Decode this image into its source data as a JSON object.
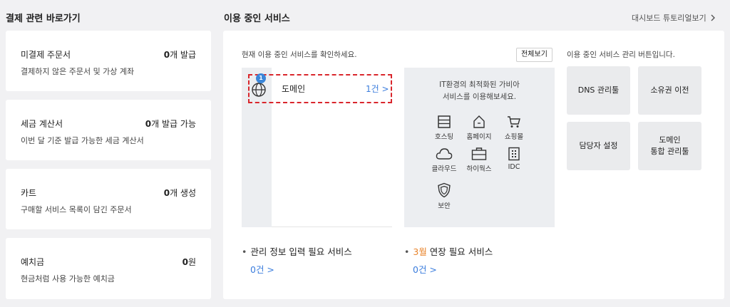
{
  "left_section": {
    "title": "결제 관련 바로가기",
    "cards": [
      {
        "title": "미결제 주문서",
        "count_num": "0",
        "count_unit": "개 발급",
        "desc": "결제하지 않은 주문서 및 가상 계좌"
      },
      {
        "title": "세금 계산서",
        "count_num": "0",
        "count_unit": "개 발급 가능",
        "desc": "이번 달 기준 발급 가능한 세금 계산서"
      },
      {
        "title": "카트",
        "count_num": "0",
        "count_unit": "개 생성",
        "desc": "구매할 서비스 목록이 담긴 주문서"
      },
      {
        "title": "예치금",
        "count_num": "0",
        "count_unit": "원",
        "desc": "현금처럼 사용 가능한 예치금"
      }
    ]
  },
  "right_section": {
    "title": "이용 중인 서비스",
    "tutorial_link": "대시보드 튜토리얼보기",
    "intro": "현재 이용 중인 서비스를 확인하세요.",
    "view_all": "전체보기",
    "domain": {
      "badge": "1",
      "label": "도메인",
      "count": "1건",
      "chevron": ">"
    },
    "promo": {
      "line1": "IT환경의 최적화된 가비아",
      "line2": "서비스를 이용해보세요.",
      "services": [
        {
          "label": "호스팅",
          "icon": "hosting-icon"
        },
        {
          "label": "홈페이지",
          "icon": "homepage-icon"
        },
        {
          "label": "쇼핑몰",
          "icon": "shopping-cart-icon"
        },
        {
          "label": "클라우드",
          "icon": "cloud-icon"
        },
        {
          "label": "하이웍스",
          "icon": "briefcase-icon"
        },
        {
          "label": "IDC",
          "icon": "idc-icon"
        },
        {
          "label": "보안",
          "icon": "shield-icon"
        }
      ]
    },
    "mgmt_desc": "이용 중인 서비스 관리 버튼입니다.",
    "mgmt_buttons": [
      "DNS 관리툴",
      "소유권 이전",
      "담당자 설정",
      "도메인",
      "통합 관리툴"
    ],
    "info_required": {
      "bullet": "•",
      "label": "관리 정보 입력 필요 서비스",
      "count": "0건 >"
    },
    "renewal": {
      "bullet": "•",
      "month": "3월",
      "label": " 연장 필요 서비스",
      "count": "0건 >"
    }
  },
  "colors": {
    "accent_blue": "#3b7ddd",
    "dashed_red": "#d9262c",
    "orange": "#e8832a",
    "badge_blue": "#3b86d8"
  }
}
